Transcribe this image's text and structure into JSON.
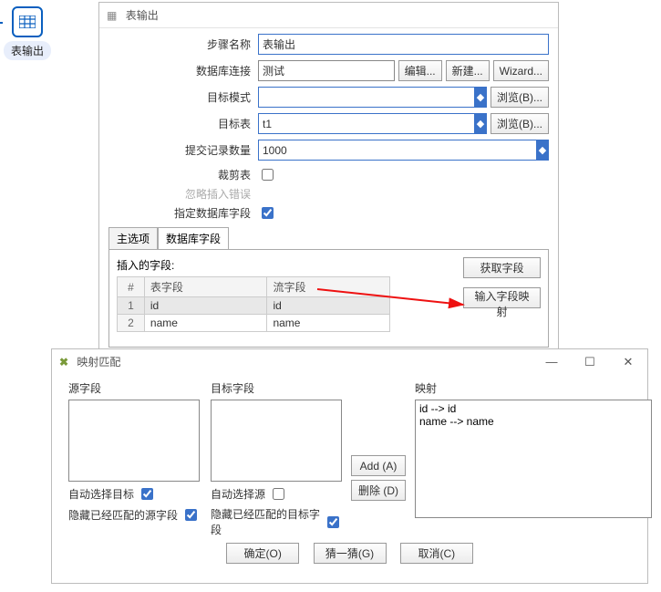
{
  "side_node_label": "表输出",
  "win1": {
    "title": "表输出",
    "rows": {
      "step_name_label": "步骤名称",
      "step_name_value": "表输出",
      "conn_label": "数据库连接",
      "conn_value": "测试",
      "edit_btn": "编辑...",
      "new_btn": "新建...",
      "wizard_btn": "Wizard...",
      "target_schema_label": "目标模式",
      "target_schema_value": "",
      "browse_btn": "浏览(B)...",
      "target_table_label": "目标表",
      "target_table_value": "t1",
      "commit_label": "提交记录数量",
      "commit_value": "1000",
      "truncate_label": "裁剪表",
      "ignore_label": "忽略插入错误",
      "specify_label": "指定数据库字段"
    },
    "tabs": {
      "main": "主选项",
      "db": "数据库字段"
    },
    "insert_label": "插入的字段:",
    "cols": {
      "hash": "#",
      "table": "表字段",
      "stream": "流字段"
    },
    "rows_data": [
      {
        "n": "1",
        "t": "id",
        "s": "id"
      },
      {
        "n": "2",
        "t": "name",
        "s": "name"
      }
    ],
    "get_fields": "获取字段",
    "field_map": "输入字段映射"
  },
  "win2": {
    "title": "映射匹配",
    "src_label": "源字段",
    "tgt_label": "目标字段",
    "map_label": "映射",
    "map_lines": [
      "id --> id",
      "name --> name"
    ],
    "add": "Add (A)",
    "del": "删除 (D)",
    "auto_tgt": "自动选择目标",
    "hide_matched_src": "隐藏已经匹配的源字段",
    "auto_src": "自动选择源",
    "hide_matched_tgt": "隐藏已经匹配的目标字段",
    "ok": "确定(O)",
    "guess": "猜一猜(G)",
    "cancel": "取消(C)"
  }
}
